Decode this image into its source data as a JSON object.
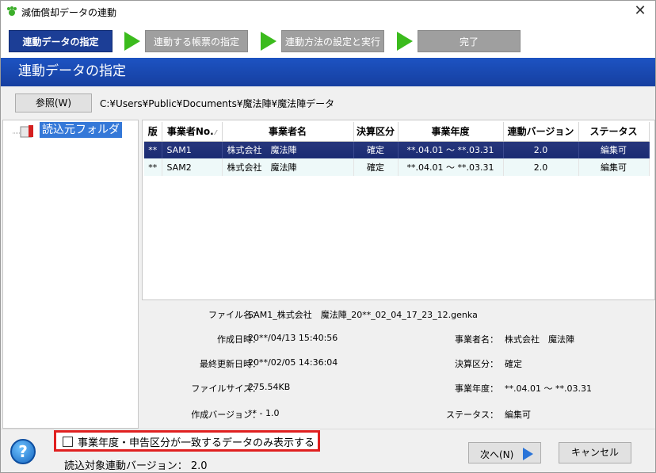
{
  "window": {
    "title": "減価償却データの連動",
    "close": "✕"
  },
  "steps": [
    {
      "label": "連動データの指定"
    },
    {
      "label": "連動する帳票の指定"
    },
    {
      "label": "連動方法の設定と実行"
    },
    {
      "label": "完了"
    }
  ],
  "header": {
    "title": "連動データの指定"
  },
  "browse": {
    "button_label": "参照(W)",
    "path": "C:¥Users¥Public¥Documents¥魔法陣¥魔法陣データ"
  },
  "tree": {
    "item_label": "読込元フォルダ"
  },
  "table": {
    "headers": [
      "版",
      "事業者No.",
      "事業者名",
      "決算区分",
      "事業年度",
      "連動バージョン",
      "ステータス"
    ],
    "rows": [
      {
        "ban": "**",
        "no": "SAM1",
        "name": "株式会社　魔法陣",
        "kessan": "確定",
        "nendo": "**.04.01 ～ **.03.31",
        "version": "2.0",
        "status": "編集可"
      },
      {
        "ban": "**",
        "no": "SAM2",
        "name": "株式会社　魔法陣",
        "kessan": "確定",
        "nendo": "**.04.01 ～ **.03.31",
        "version": "2.0",
        "status": "編集可"
      }
    ]
  },
  "details": {
    "file_name_label": "ファイル名：",
    "file_name": "SAM1_株式会社　魔法陣_20**_02_04_17_23_12.genka",
    "created_label": "作成日時：",
    "created": "20**/04/13 15:40:56",
    "updated_label": "最終更新日時：",
    "updated": "20**/02/05 14:36:04",
    "size_label": "ファイルサイズ：",
    "size": "275.54KB",
    "made_version_label": "作成バージョン：",
    "made_version": "** - 1.0",
    "company_label": "事業者名：",
    "company": "株式会社　魔法陣",
    "kessan_label": "決算区分：",
    "kessan": "確定",
    "nendo_label": "事業年度：",
    "nendo": "**.04.01 ～ **.03.31",
    "status_label": "ステータス：",
    "status": "編集可"
  },
  "footer": {
    "help": "?",
    "filter_label": "事業年度・申告区分が一致するデータのみ表示する",
    "filter_checked": false,
    "version_text": "読込対象連動バージョン： 2.0",
    "next_label": "次へ(N)",
    "cancel_label": "キャンセル"
  },
  "colors": {
    "active_step": "#1c3e96",
    "header_band": "#1d53c2",
    "selected_row": "#1a2b72",
    "step_arrow": "#3bbb1d",
    "highlight_border": "#e02020"
  }
}
